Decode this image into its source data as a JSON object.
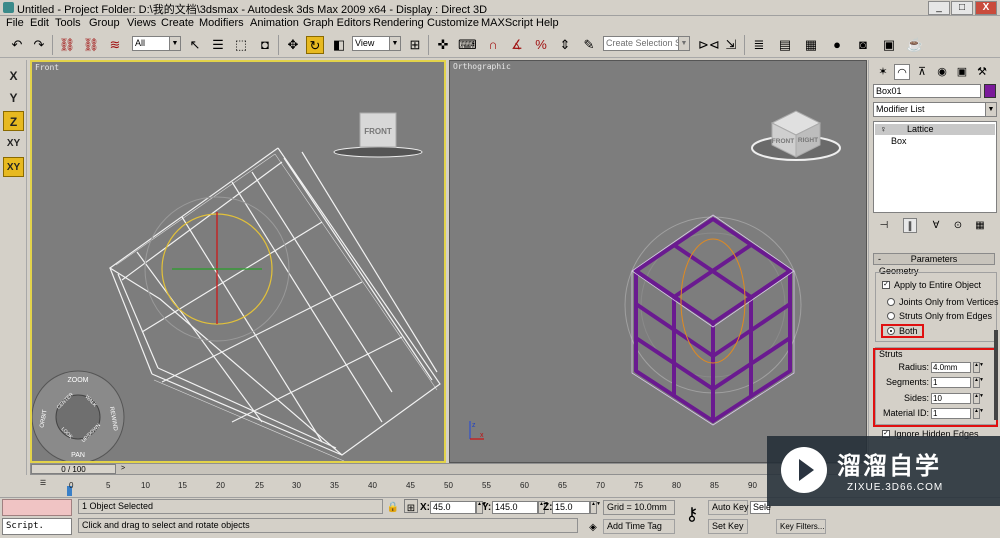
{
  "window": {
    "title": "Untitled      - Project Folder: D:\\我的文档\\3dsmax      - Autodesk 3ds Max  2009 x64      - Display : Direct 3D",
    "minimize": "_",
    "maximize": "□",
    "close": "X"
  },
  "menu": [
    "File",
    "Edit",
    "Tools",
    "Group",
    "Views",
    "Create",
    "Modifiers",
    "Animation",
    "Graph Editors",
    "Rendering",
    "Customize",
    "MAXScript",
    "Help"
  ],
  "toolbar": {
    "selection_filter": "All",
    "reference_coord": "View",
    "named_selection_placeholder": "Create Selection Set"
  },
  "axis_constraints": [
    "X",
    "Y",
    "Z",
    "XY",
    "XY"
  ],
  "viewports": {
    "front_label": "Front",
    "ortho_label": "Orthographic",
    "viewcube_front": "FRONT",
    "viewcube_right": "RIGHT",
    "steering_wheel": [
      "ZOOM",
      "ORBIT",
      "CENTER",
      "WALK",
      "REWIND",
      "LOOK",
      "UP/DOWN",
      "PAN"
    ]
  },
  "command_panel": {
    "object_name": "Box01",
    "object_color": "#7a1a9a",
    "modifier_list": "Modifier List",
    "stack": [
      "Lattice",
      "Box"
    ],
    "rollout_title": "Parameters",
    "geometry_label": "Geometry",
    "apply_entire": "Apply to Entire Object",
    "options": [
      "Joints Only from Vertices",
      "Struts Only from Edges",
      "Both"
    ],
    "selected_option": "Both",
    "struts_label": "Struts",
    "fields": [
      {
        "label": "Radius:",
        "value": "4.0mm"
      },
      {
        "label": "Segments:",
        "value": "1"
      },
      {
        "label": "Sides:",
        "value": "10"
      },
      {
        "label": "Material ID:",
        "value": "1"
      }
    ],
    "ignore_hidden": "Ignore Hidden Edges"
  },
  "timeline": {
    "frame_counter": "0 / 100",
    "ticks": [
      "0",
      "5",
      "10",
      "15",
      "20",
      "25",
      "30",
      "35",
      "40",
      "45",
      "50",
      "55",
      "60",
      "65",
      "70",
      "75",
      "80",
      "85",
      "90"
    ]
  },
  "status": {
    "listener": "Script.",
    "selection": "1 Object Selected",
    "prompt": "Click and drag to select and rotate objects",
    "x_label": "X:",
    "x_value": "45.0",
    "y_label": "Y:",
    "y_value": "145.0",
    "z_label": "Z:",
    "z_value": "15.0",
    "grid": "Grid = 10.0mm",
    "add_time_tag": "Add Time Tag",
    "auto_key": "Auto Key",
    "set_key": "Set Key",
    "selected": "Sele",
    "key_filters": "Key Filters..."
  },
  "watermark": {
    "title": "溜溜自学",
    "subtitle": "ZIXUE.3D66.COM"
  }
}
